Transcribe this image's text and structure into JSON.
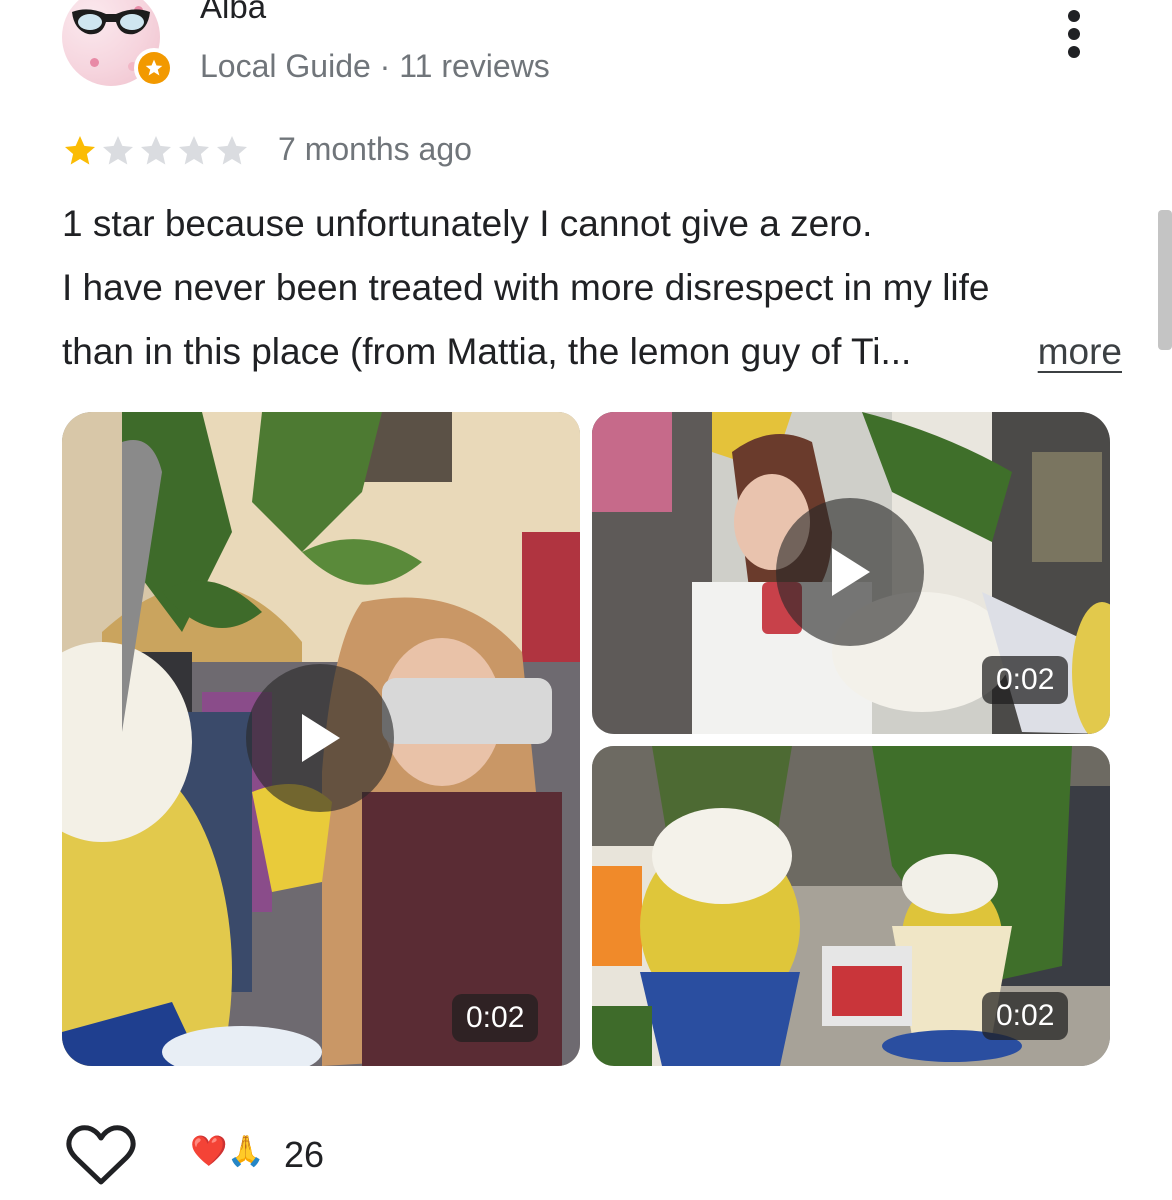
{
  "reviewer": {
    "name": "Alba",
    "badge": "Local Guide",
    "separator": " · ",
    "review_count": "11 reviews"
  },
  "rating": {
    "stars": 1,
    "max_stars": 5,
    "time_ago": "7 months ago",
    "filled_color": "#fbbc04",
    "empty_color": "#dadce0"
  },
  "review": {
    "line1": "1 star because unfortunately I cannot give a zero.",
    "line2": "I have never been treated with more disrespect in my life",
    "line3": "than in this place (from Mattia, the lemon guy of Ti...",
    "more_label": "more"
  },
  "media": [
    {
      "duration": "0:02"
    },
    {
      "duration": "0:02"
    },
    {
      "duration": "0:02"
    }
  ],
  "footer": {
    "reactions": "❤️🙏",
    "reaction_count": "26"
  },
  "icons": {
    "menu": "more-vert-icon",
    "like": "heart-outline-icon",
    "play": "play-icon",
    "badge": "local-guide-star-icon"
  }
}
